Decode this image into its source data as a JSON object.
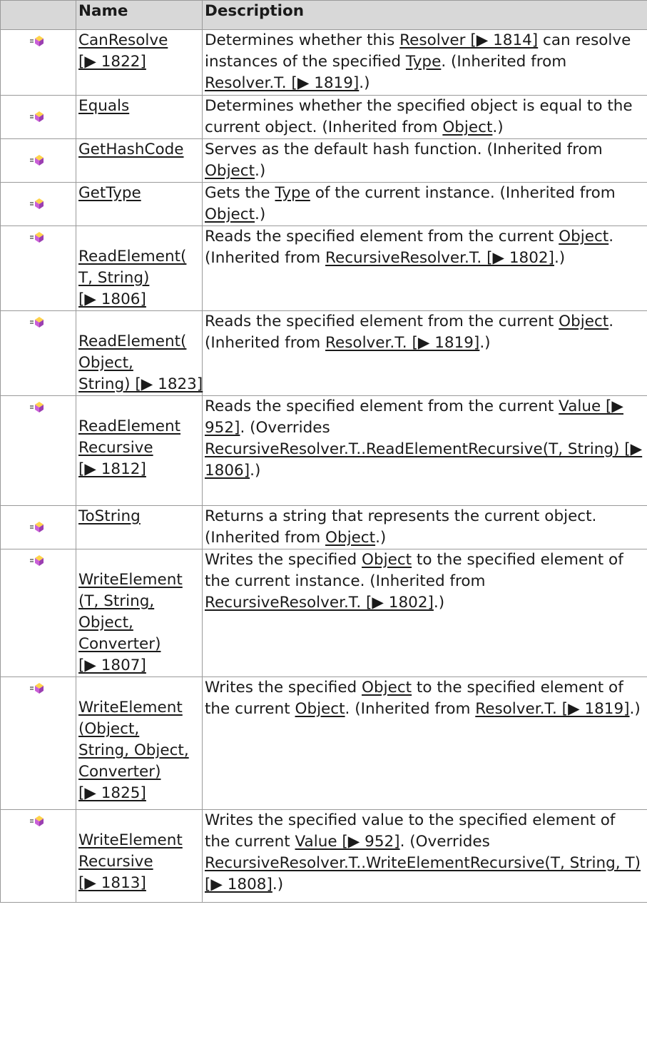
{
  "header": {
    "name": "Name",
    "description": "Description"
  },
  "icon": "public-method-icon",
  "rows": [
    {
      "name": [
        "CanResolve",
        "[▶ 1822]"
      ],
      "desc": [
        "Determines whether this ",
        "Resolver [▶ 1814]",
        " can resolve instances of the specified ",
        "Type",
        ". (Inherited from ",
        "Resolver.T. [▶ 1819]",
        ".)"
      ]
    },
    {
      "name": [
        "Equals"
      ],
      "desc": [
        "Determines whether the specified object is equal to the current object. (Inherited from ",
        "Object",
        ".)"
      ]
    },
    {
      "name": [
        "GetHashCode"
      ],
      "desc": [
        "Serves as the default hash function. (Inherited from ",
        "Object",
        ".)"
      ]
    },
    {
      "name": [
        "GetType"
      ],
      "desc": [
        "Gets the ",
        "Type",
        " of the current instance. (Inherited from ",
        "Object",
        ".)"
      ]
    },
    {
      "name": [
        "ReadElement(",
        "T, String)",
        "[▶ 1806]"
      ],
      "desc": [
        "Reads the specified element from the current ",
        "Object",
        ". (Inherited from ",
        "RecursiveResolver.T. [▶ 1802]",
        ".)"
      ]
    },
    {
      "name": [
        "ReadElement(",
        "Object,",
        "String) [▶ 1823]"
      ],
      "desc": [
        "Reads the specified element from the current ",
        "Object",
        ". (Inherited from ",
        "Resolver.T. [▶ 1819]",
        ".)"
      ]
    },
    {
      "name": [
        "ReadElement",
        "Recursive",
        "[▶ 1812]"
      ],
      "desc": [
        "Reads the specified element from the current ",
        "Value [▶ 952]",
        ". (Overrides ",
        "RecursiveResolver.T..ReadElementRecursive(T, String) [▶ 1806]",
        ".)"
      ]
    },
    {
      "name": [
        "ToString"
      ],
      "desc": [
        "Returns a string that represents the current object. (Inherited from ",
        "Object",
        ".)"
      ]
    },
    {
      "name": [
        "WriteElement",
        "(T, String,",
        "Object,",
        "Converter)",
        "[▶ 1807]"
      ],
      "desc": [
        "Writes the specified ",
        "Object",
        " to the specified element of the current instance. (Inherited from ",
        "RecursiveResolver.T. [▶ 1802]",
        ".)"
      ]
    },
    {
      "name": [
        "WriteElement",
        "(Object,",
        "String, Object,",
        "Converter)",
        "[▶ 1825]"
      ],
      "desc": [
        "Writes the specified ",
        "Object",
        " to the specified element of the current ",
        "Object",
        ". (Inherited from ",
        "Resolver.T. [▶ 1819]",
        ".)"
      ]
    },
    {
      "name": [
        "WriteElement",
        "Recursive",
        "[▶ 1813]"
      ],
      "desc": [
        "Writes the specified value to the specified element of the current ",
        "Value [▶ 952]",
        ". (Overrides ",
        "RecursiveResolver.T..WriteElementRecursive(T, String, T) [▶ 1808]",
        ".)"
      ]
    }
  ]
}
